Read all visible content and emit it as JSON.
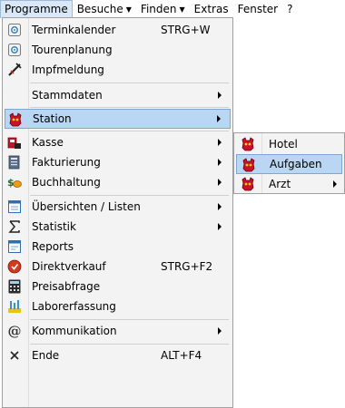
{
  "menubar": {
    "items": [
      {
        "label": "Programme",
        "open": true
      },
      {
        "label": "Besuche",
        "dropdown": true
      },
      {
        "label": "Finden",
        "dropdown": true
      },
      {
        "label": "Extras"
      },
      {
        "label": "Fenster"
      },
      {
        "label": "?"
      }
    ]
  },
  "menu": {
    "items": [
      {
        "label": "Terminkalender",
        "shortcut": "STRG+W",
        "icon": "calendar-icon"
      },
      {
        "label": "Tourenplanung",
        "icon": "calendar-icon"
      },
      {
        "label": "Impfmeldung",
        "icon": "syringe-icon"
      },
      {
        "label": "Stammdaten",
        "submenu": true
      },
      {
        "label": "Station",
        "submenu": true,
        "icon": "animal-icon",
        "highlighted": true
      },
      {
        "label": "Kasse",
        "submenu": true,
        "icon": "cash-register-icon"
      },
      {
        "label": "Fakturierung",
        "submenu": true,
        "icon": "invoice-icon"
      },
      {
        "label": "Buchhaltung",
        "submenu": true,
        "icon": "money-icon"
      },
      {
        "label": "Übersichten / Listen",
        "submenu": true,
        "icon": "list-window-icon"
      },
      {
        "label": "Statistik",
        "submenu": true,
        "icon": "sigma-icon"
      },
      {
        "label": "Reports",
        "icon": "report-window-icon"
      },
      {
        "label": "Direktverkauf",
        "shortcut": "STRG+F2",
        "icon": "sale-icon"
      },
      {
        "label": "Preisabfrage",
        "icon": "calculator-icon"
      },
      {
        "label": "Laborerfassung",
        "icon": "lab-icon"
      },
      {
        "label": "Kommunikation",
        "submenu": true,
        "icon": "at-icon"
      },
      {
        "label": "Ende",
        "shortcut": "ALT+F4",
        "icon": "exit-x-icon"
      }
    ]
  },
  "submenu": {
    "items": [
      {
        "label": "Hotel",
        "icon": "animal-icon"
      },
      {
        "label": "Aufgaben",
        "icon": "animal-icon",
        "highlighted": true
      },
      {
        "label": "Arzt",
        "icon": "animal-icon",
        "submenu": true
      }
    ]
  },
  "colors": {
    "highlight": "#b9d7f2",
    "highlight_border": "#7ea6d4",
    "menu_bg": "#f3f3f3"
  }
}
